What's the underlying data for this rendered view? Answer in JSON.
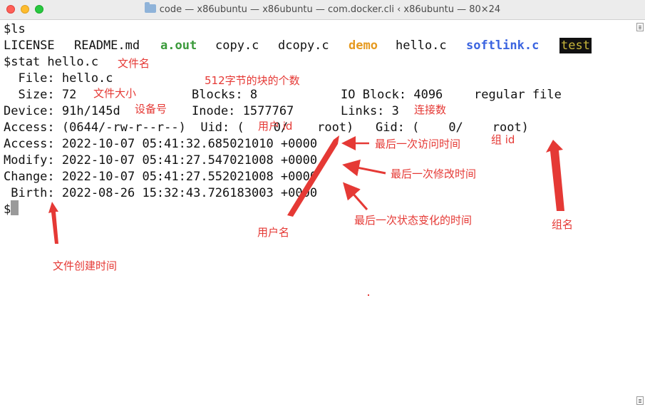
{
  "window": {
    "title": "code — x86ubuntu — x86ubuntu — com.docker.cli ‹ x86ubuntu — 80×24"
  },
  "terminal": {
    "cmd1": "$ls",
    "ls": {
      "license": "LICENSE",
      "readme": "README.md",
      "aout": "a.out",
      "copy": "copy.c",
      "dcopy": "dcopy.c",
      "demo": "demo",
      "hello": "hello.c",
      "softlink": "softlink.c",
      "test": "test"
    },
    "cmd2": "$stat hello.c",
    "file_line": "  File: hello.c",
    "size_line": "  Size: 72",
    "blocks": "Blocks: 8",
    "ioblock": "IO Block: 4096",
    "filetype": "regular file",
    "device": "Device: 91h/145d",
    "inode": "Inode: 1577767",
    "links": "Links: 3",
    "access_perm": "Access: (0644/-rw-r--r--)  Uid: (    0/    root)   Gid: (    0/    root)",
    "access_time": "Access: 2022-10-07 05:41:32.685021010 +0000",
    "modify_time": "Modify: 2022-10-07 05:41:27.547021008 +0000",
    "change_time": "Change: 2022-10-07 05:41:27.552021008 +0000",
    "birth_time": " Birth: 2022-08-26 15:32:43.726183003 +0000",
    "prompt": "$"
  },
  "annotations": {
    "filename": "文件名",
    "block512": "512字节的块的个数",
    "filesize": "文件大小",
    "device_no": "设备号",
    "link_count": "连接数",
    "user_id": "用户 id",
    "group_id": "组 id",
    "last_access": "最后一次访问时间",
    "last_modify": "最后一次修改时间",
    "last_change": "最后一次状态变化的时间",
    "username": "用户名",
    "groupname": "组名",
    "create_time": "文件创建时间"
  },
  "colors": {
    "annotation": "#e53935",
    "green": "#3a9a3a",
    "orange": "#e69a20",
    "blue": "#3b64e0"
  },
  "icons": [
    "folder-icon",
    "close-icon",
    "minimize-icon",
    "zoom-icon"
  ]
}
